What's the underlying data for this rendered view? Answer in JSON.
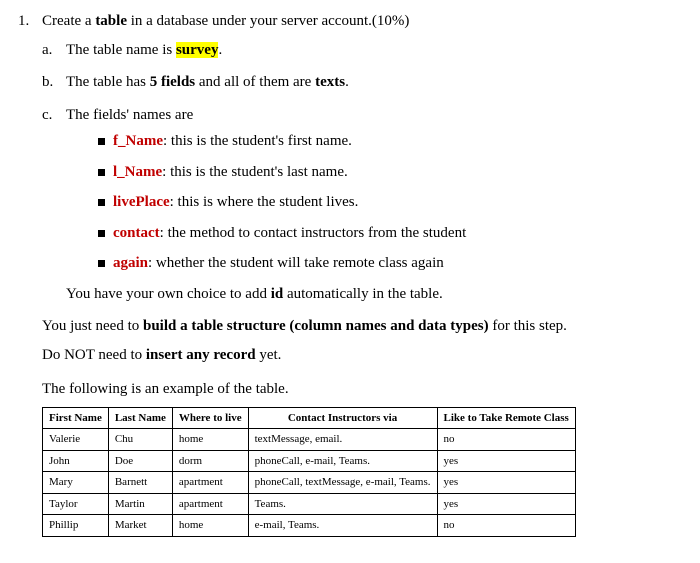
{
  "q1": {
    "num": "1.",
    "text_before": "Create a ",
    "bold1": "table",
    "text_after": " in a database under your server account.(10%)"
  },
  "a": {
    "let": "a.",
    "t1": "The table name is ",
    "hl": "survey",
    "t2": "."
  },
  "b": {
    "let": "b.",
    "t1": "The table has ",
    "b1": "5 fields",
    "t2": " and all of them are ",
    "b2": "texts",
    "t3": "."
  },
  "c": {
    "let": "c.",
    "t1": "The fields' names are"
  },
  "fields": [
    {
      "name": "f_Name",
      "desc": ": this is the student's first name."
    },
    {
      "name": "l_Name",
      "desc": ": this is the student's last name."
    },
    {
      "name": "livePlace",
      "desc": ": this is where the student lives."
    },
    {
      "name": "contact",
      "desc": ": the method to contact instructors from the student"
    },
    {
      "name": "again",
      "desc": ": whether the student will take remote class again"
    }
  ],
  "tail": {
    "t1": "You have your own choice to add ",
    "b1": "id",
    "t2": " automatically in the table."
  },
  "p1": {
    "t1": "You just need to ",
    "b1": "build a table structure (column names and data types)",
    "t2": " for this step."
  },
  "p2": {
    "t1": "Do NOT need to ",
    "b1": "insert any record",
    "t2": " yet."
  },
  "p3": "The following is an example of the table.",
  "table": {
    "headers": [
      "First Name",
      "Last Name",
      "Where to live",
      "Contact Instructors via",
      "Like to Take Remote Class"
    ],
    "rows": [
      [
        "Valerie",
        "Chu",
        "home",
        "textMessage, email.",
        "no"
      ],
      [
        "John",
        "Doe",
        "dorm",
        "phoneCall, e-mail, Teams.",
        "yes"
      ],
      [
        "Mary",
        "Barnett",
        "apartment",
        "phoneCall, textMessage, e-mail, Teams.",
        "yes"
      ],
      [
        "Taylor",
        "Martin",
        "apartment",
        "Teams.",
        "yes"
      ],
      [
        "Phillip",
        "Market",
        "home",
        "e-mail, Teams.",
        "no"
      ]
    ]
  }
}
